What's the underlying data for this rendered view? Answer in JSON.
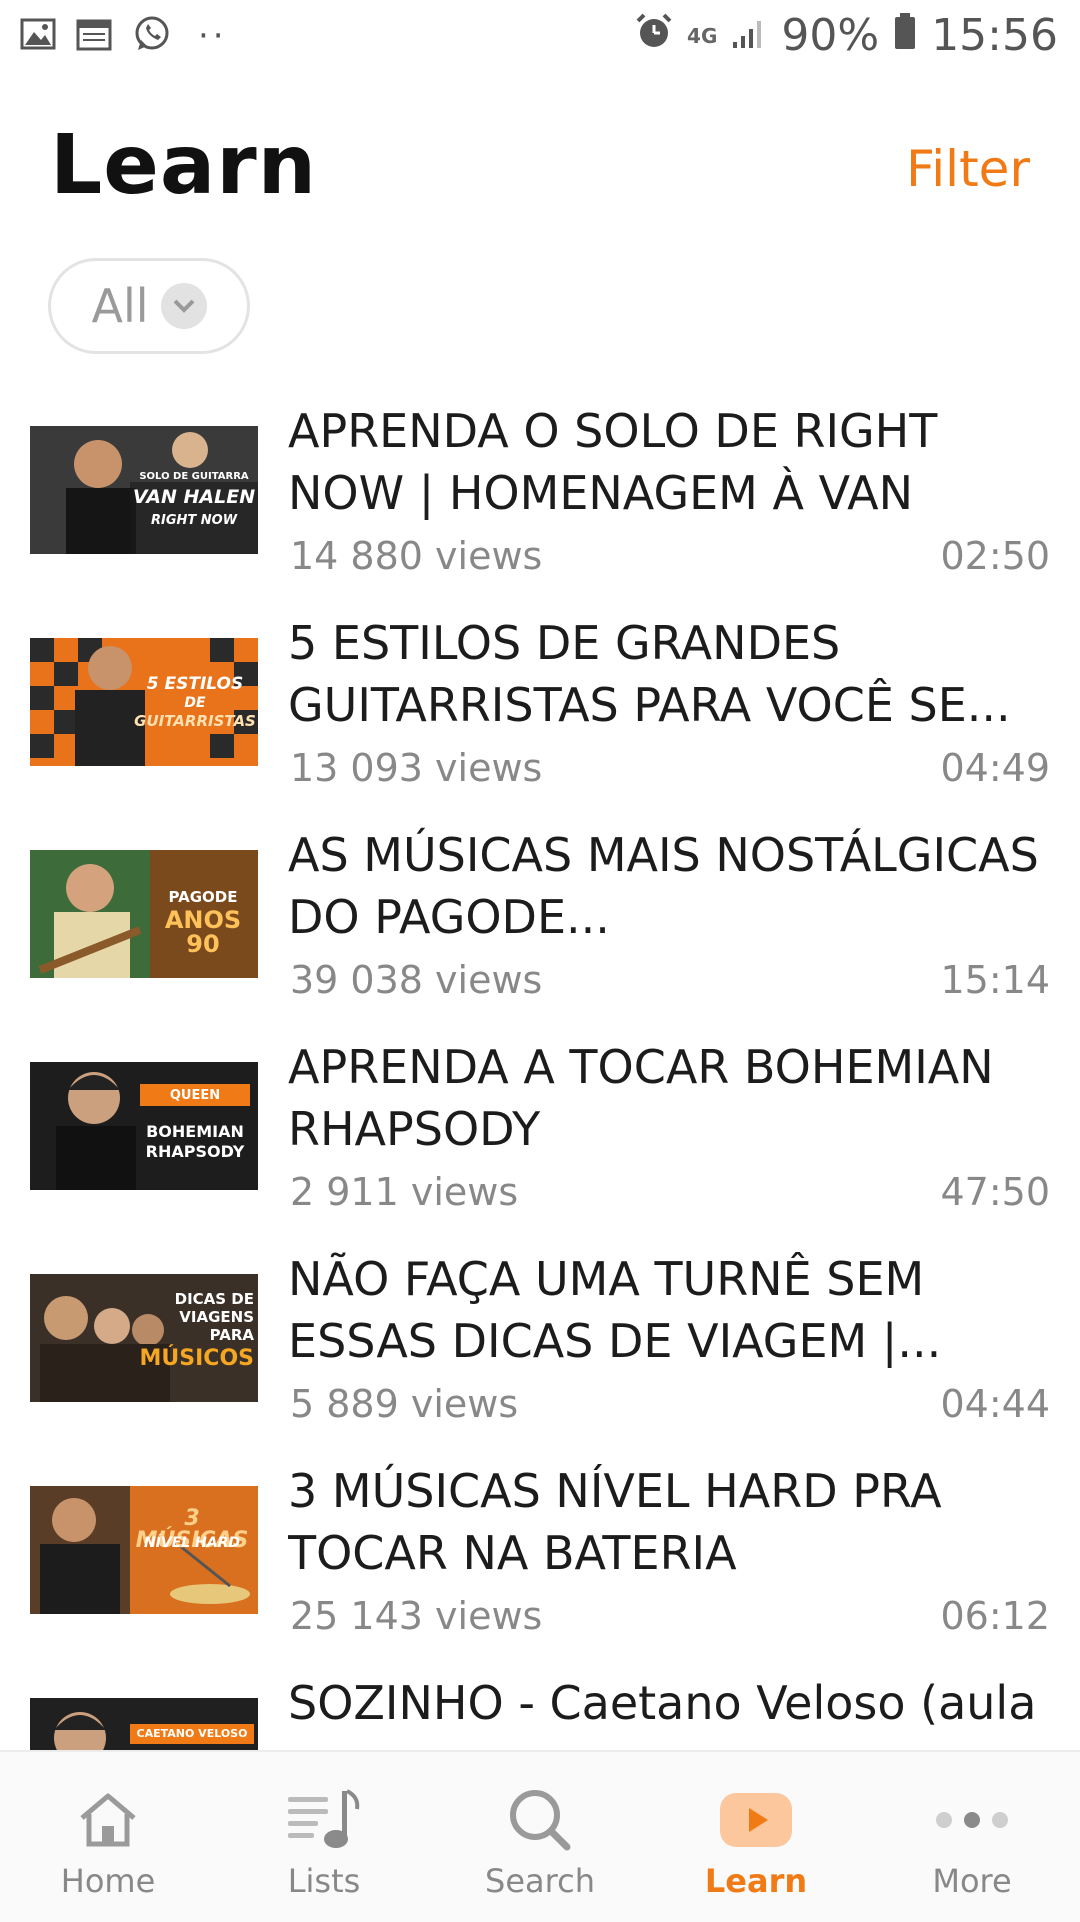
{
  "status_bar": {
    "battery": "90%",
    "time": "15:56",
    "network": "4G"
  },
  "header": {
    "title": "Learn",
    "filter_label": "Filter"
  },
  "filter_chip": {
    "label": "All"
  },
  "videos": [
    {
      "title": "APRENDA O SOLO DE RIGHT NOW | HOMENAGEM À VAN HALEN",
      "views": "14 880 views",
      "duration": "02:50",
      "thumb": {
        "lines": [
          "SOLO DE GUITARRA",
          "VAN HALEN",
          "RIGHT NOW"
        ]
      }
    },
    {
      "title": "5 ESTILOS DE GRANDES GUITARRISTAS PARA VOCÊ SE...",
      "views": "13 093 views",
      "duration": "04:49",
      "thumb": {
        "lines": [
          "5 ESTILOS",
          "DE",
          "GUITARRISTAS"
        ]
      }
    },
    {
      "title": "AS MÚSICAS MAIS NOSTÁLGICAS DO PAGODE...",
      "views": "39 038 views",
      "duration": "15:14",
      "thumb": {
        "lines": [
          "PAGODE",
          "ANOS 90"
        ]
      }
    },
    {
      "title": "APRENDA A TOCAR BOHEMIAN RHAPSODY",
      "views": "2 911 views",
      "duration": "47:50",
      "thumb": {
        "lines": [
          "QUEEN",
          "BOHEMIAN",
          "RHAPSODY"
        ]
      }
    },
    {
      "title": "NÃO FAÇA UMA TURNÊ SEM ESSAS DICAS DE VIAGEM |...",
      "views": "5 889 views",
      "duration": "04:44",
      "thumb": {
        "lines": [
          "DICAS DE",
          "VIAGENS",
          "PARA",
          "MÚSICOS"
        ]
      }
    },
    {
      "title": "3 MÚSICAS NÍVEL HARD PRA TOCAR NA BATERIA",
      "views": "25 143 views",
      "duration": "06:12",
      "thumb": {
        "lines": [
          "3 MÚSICAS",
          "NÍVEL HARD"
        ]
      }
    },
    {
      "title": "SOZINHO - Caetano Veloso (aula",
      "views": "",
      "duration": "",
      "thumb": {
        "lines": [
          "CAETANO VELOSO"
        ]
      }
    }
  ],
  "bottom_nav": [
    {
      "label": "Home",
      "icon": "home-icon"
    },
    {
      "label": "Lists",
      "icon": "music-list-icon"
    },
    {
      "label": "Search",
      "icon": "search-icon"
    },
    {
      "label": "Learn",
      "icon": "play-icon",
      "active": true
    },
    {
      "label": "More",
      "icon": "more-dots-icon"
    }
  ],
  "colors": {
    "accent": "#f07b16",
    "text": "#1c1c1c",
    "muted": "#888888"
  }
}
